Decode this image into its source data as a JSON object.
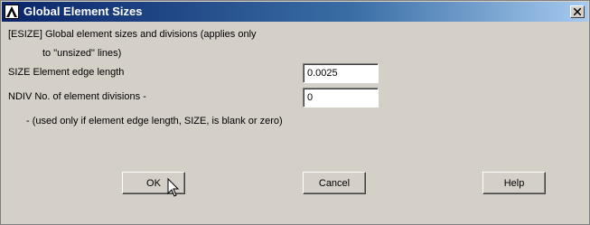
{
  "window": {
    "title": "Global Element Sizes"
  },
  "form": {
    "esize_line1": "[ESIZE]  Global element sizes and divisions (applies only",
    "esize_line2": "to \"unsized\" lines)",
    "size_label": "SIZE  Element edge length",
    "size_value": "0.0025",
    "ndiv_label": "NDIV  No. of element divisions -",
    "ndiv_value": "0",
    "note": "- (used only if element edge length, SIZE, is blank or zero)"
  },
  "buttons": {
    "ok": "OK",
    "cancel": "Cancel",
    "help": "Help"
  },
  "icons": {
    "app": "ansys-logo-icon",
    "close": "close-icon",
    "pointer": "mouse-pointer-icon"
  }
}
